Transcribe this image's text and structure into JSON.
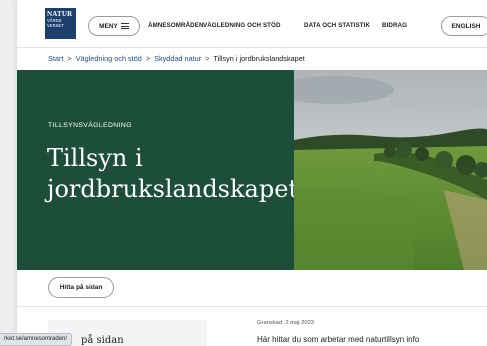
{
  "logo": {
    "line1": "NATUR",
    "line2": "VÅRDS",
    "line3": "VERKET"
  },
  "header": {
    "menu_label": "MENY",
    "nav": [
      "ÄMNESOMRÅDEN",
      "VÄGLEDNING OCH STÖD",
      "DATA OCH STATISTIK",
      "BIDRAG"
    ],
    "lang_label": "ENGLISH"
  },
  "breadcrumb": [
    "Start",
    "Vägledning och stöd",
    "Skyddad natur",
    "Tillsyn i jordbrukslandskapet"
  ],
  "breadcrumb_sep": ">",
  "hero": {
    "kicker": "TILLSYNSVÄGLEDNING",
    "title": "Tillsyn i jordbrukslandskapet",
    "bg_color": "#1c4e3a"
  },
  "toc_button": "Hitta på sidan",
  "toc_heading_partial": "på sidan",
  "article": {
    "date": "Granskad: 2 maj 2023",
    "intro_partial": "Här hittar du som arbetar med naturtillsyn info"
  },
  "status_bar_url": "rket.se/amnesomraden/"
}
